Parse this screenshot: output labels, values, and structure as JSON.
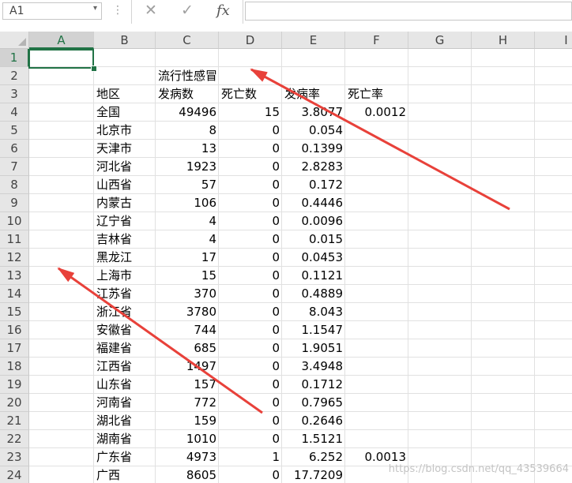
{
  "formula_bar": {
    "name_box": "A1",
    "name_box_arrow": "▾",
    "dots": "⋮",
    "cancel_icon": "✕",
    "enter_icon": "✓",
    "fx_label": "fx",
    "formula": ""
  },
  "columns": [
    "A",
    "B",
    "C",
    "D",
    "E",
    "F",
    "G",
    "H",
    "I"
  ],
  "selected_column": "A",
  "selected_row": 1,
  "rows": [
    1,
    2,
    3,
    4,
    5,
    6,
    7,
    8,
    9,
    10,
    11,
    12,
    13,
    14,
    15,
    16,
    17,
    18,
    19,
    20,
    21,
    22,
    23,
    24
  ],
  "sheet": {
    "title": "流行性感冒",
    "headers": [
      "地区",
      "发病数",
      "死亡数",
      "发病率",
      "死亡率"
    ],
    "data": [
      [
        "全国",
        "49496",
        "15",
        "3.8077",
        "0.0012"
      ],
      [
        "北京市",
        "8",
        "0",
        "0.054",
        ""
      ],
      [
        "天津市",
        "13",
        "0",
        "0.1399",
        ""
      ],
      [
        "河北省",
        "1923",
        "0",
        "2.8283",
        ""
      ],
      [
        "山西省",
        "57",
        "0",
        "0.172",
        ""
      ],
      [
        "内蒙古",
        "106",
        "0",
        "0.4446",
        ""
      ],
      [
        "辽宁省",
        "4",
        "0",
        "0.0096",
        ""
      ],
      [
        "吉林省",
        "4",
        "0",
        "0.015",
        ""
      ],
      [
        "黑龙江",
        "17",
        "0",
        "0.0453",
        ""
      ],
      [
        "上海市",
        "15",
        "0",
        "0.1121",
        ""
      ],
      [
        "江苏省",
        "370",
        "0",
        "0.4889",
        ""
      ],
      [
        "浙江省",
        "3780",
        "0",
        "8.043",
        ""
      ],
      [
        "安徽省",
        "744",
        "0",
        "1.1547",
        ""
      ],
      [
        "福建省",
        "685",
        "0",
        "1.9051",
        ""
      ],
      [
        "江西省",
        "1497",
        "0",
        "3.4948",
        ""
      ],
      [
        "山东省",
        "157",
        "0",
        "0.1712",
        ""
      ],
      [
        "河南省",
        "772",
        "0",
        "0.7965",
        ""
      ],
      [
        "湖北省",
        "159",
        "0",
        "0.2646",
        ""
      ],
      [
        "湖南省",
        "1010",
        "0",
        "1.5121",
        ""
      ],
      [
        "广东省",
        "4973",
        "1",
        "6.252",
        "0.0013"
      ],
      [
        "广西",
        "8605",
        "0",
        "17.7209",
        ""
      ]
    ]
  },
  "watermark": "https://blog.csdn.net/qq_43539664",
  "colors": {
    "accent": "#217346",
    "arrow": "#e8413a",
    "header_bg": "#e6e6e6"
  }
}
